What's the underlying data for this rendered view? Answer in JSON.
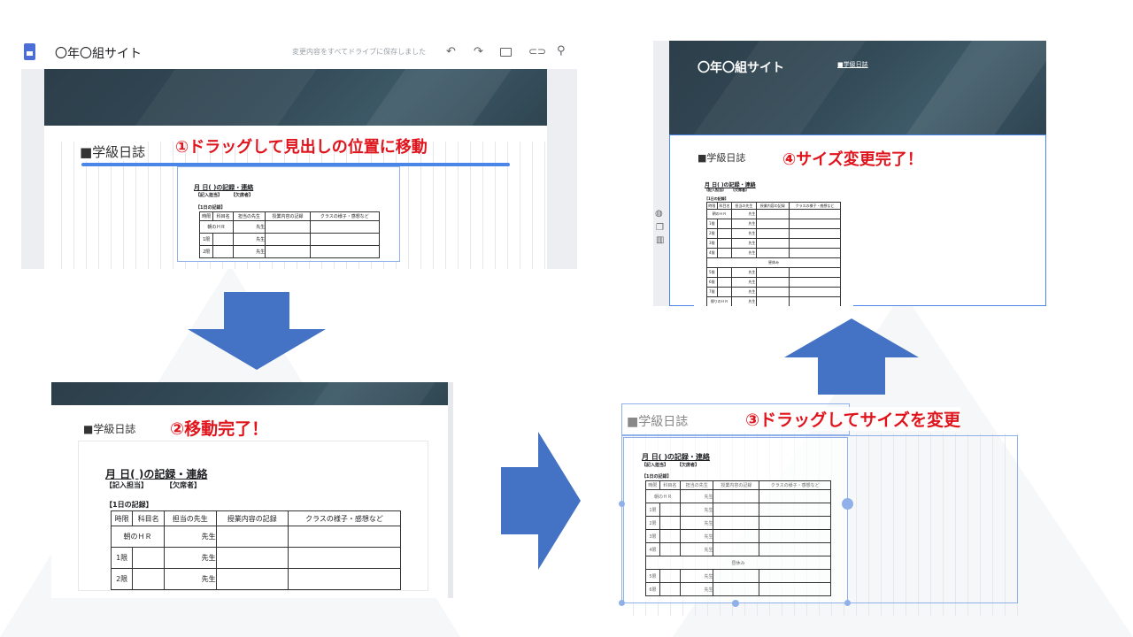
{
  "app": {
    "doc_icon": "google-sites-icon",
    "title": "〇年〇組サイト",
    "save_status": "変更内容をすべてドライブに保存しました",
    "toolbar_icons": [
      "undo-icon",
      "redo-icon",
      "preview-icon",
      "link-icon",
      "share-icon"
    ]
  },
  "section_heading": "■学級日誌",
  "site_header": {
    "title": "〇年〇組サイト",
    "nav_link": "■学級日誌"
  },
  "annotations": {
    "step1": "①ドラッグして見出しの位置に移動",
    "step2": "②移動完了！",
    "step3": "③ドラッグしてサイズを変更",
    "step4": "④サイズ変更完了！"
  },
  "journal": {
    "title": "月 日( )の記録・連絡",
    "assigned_label": "【記入担当】",
    "absent_label": "【欠席者】",
    "section_label": "【1日の記録】",
    "columns": [
      "時限",
      "科目名",
      "担当の先生",
      "授業内容の記録",
      "クラスの様子・感想など"
    ],
    "homeroom_label": "朝のＨＲ",
    "teacher_suffix": "先生",
    "periods": [
      "1限",
      "2限",
      "3限",
      "4限",
      "5限",
      "6限",
      "7限"
    ],
    "lunch_label": "昼休み",
    "afterschool_label": "帰りのＨＲ"
  },
  "side_tools": [
    "palette-icon",
    "duplicate-icon",
    "delete-icon"
  ],
  "colors": {
    "annotation": "#e0141c",
    "arrow": "#4472c4",
    "selection": "#4a86e8",
    "banner": "#2f4551"
  }
}
